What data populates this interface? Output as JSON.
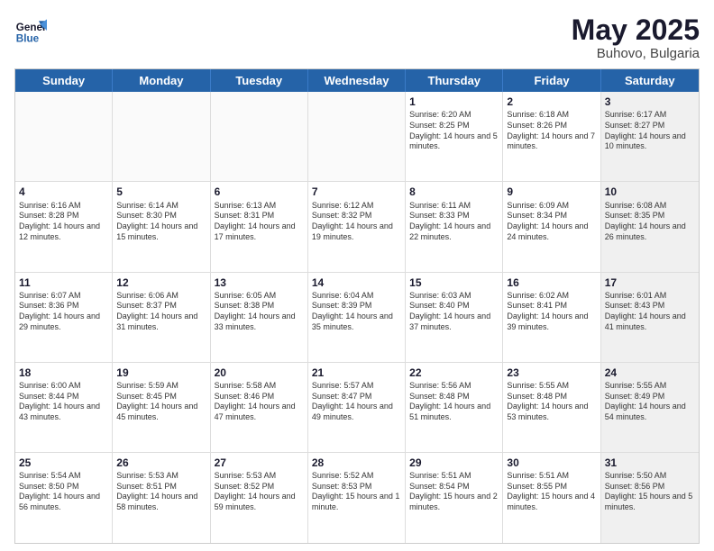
{
  "header": {
    "logo_general": "General",
    "logo_blue": "Blue",
    "title": "May 2025",
    "subtitle": "Buhovo, Bulgaria"
  },
  "days": [
    "Sunday",
    "Monday",
    "Tuesday",
    "Wednesday",
    "Thursday",
    "Friday",
    "Saturday"
  ],
  "weeks": [
    [
      {
        "day": "",
        "empty": true
      },
      {
        "day": "",
        "empty": true
      },
      {
        "day": "",
        "empty": true
      },
      {
        "day": "",
        "empty": true
      },
      {
        "day": "1",
        "sunrise": "Sunrise: 6:20 AM",
        "sunset": "Sunset: 8:25 PM",
        "daylight": "Daylight: 14 hours and 5 minutes."
      },
      {
        "day": "2",
        "sunrise": "Sunrise: 6:18 AM",
        "sunset": "Sunset: 8:26 PM",
        "daylight": "Daylight: 14 hours and 7 minutes."
      },
      {
        "day": "3",
        "sunrise": "Sunrise: 6:17 AM",
        "sunset": "Sunset: 8:27 PM",
        "daylight": "Daylight: 14 hours and 10 minutes.",
        "shaded": true
      }
    ],
    [
      {
        "day": "4",
        "sunrise": "Sunrise: 6:16 AM",
        "sunset": "Sunset: 8:28 PM",
        "daylight": "Daylight: 14 hours and 12 minutes."
      },
      {
        "day": "5",
        "sunrise": "Sunrise: 6:14 AM",
        "sunset": "Sunset: 8:30 PM",
        "daylight": "Daylight: 14 hours and 15 minutes."
      },
      {
        "day": "6",
        "sunrise": "Sunrise: 6:13 AM",
        "sunset": "Sunset: 8:31 PM",
        "daylight": "Daylight: 14 hours and 17 minutes."
      },
      {
        "day": "7",
        "sunrise": "Sunrise: 6:12 AM",
        "sunset": "Sunset: 8:32 PM",
        "daylight": "Daylight: 14 hours and 19 minutes."
      },
      {
        "day": "8",
        "sunrise": "Sunrise: 6:11 AM",
        "sunset": "Sunset: 8:33 PM",
        "daylight": "Daylight: 14 hours and 22 minutes."
      },
      {
        "day": "9",
        "sunrise": "Sunrise: 6:09 AM",
        "sunset": "Sunset: 8:34 PM",
        "daylight": "Daylight: 14 hours and 24 minutes."
      },
      {
        "day": "10",
        "sunrise": "Sunrise: 6:08 AM",
        "sunset": "Sunset: 8:35 PM",
        "daylight": "Daylight: 14 hours and 26 minutes.",
        "shaded": true
      }
    ],
    [
      {
        "day": "11",
        "sunrise": "Sunrise: 6:07 AM",
        "sunset": "Sunset: 8:36 PM",
        "daylight": "Daylight: 14 hours and 29 minutes."
      },
      {
        "day": "12",
        "sunrise": "Sunrise: 6:06 AM",
        "sunset": "Sunset: 8:37 PM",
        "daylight": "Daylight: 14 hours and 31 minutes."
      },
      {
        "day": "13",
        "sunrise": "Sunrise: 6:05 AM",
        "sunset": "Sunset: 8:38 PM",
        "daylight": "Daylight: 14 hours and 33 minutes."
      },
      {
        "day": "14",
        "sunrise": "Sunrise: 6:04 AM",
        "sunset": "Sunset: 8:39 PM",
        "daylight": "Daylight: 14 hours and 35 minutes."
      },
      {
        "day": "15",
        "sunrise": "Sunrise: 6:03 AM",
        "sunset": "Sunset: 8:40 PM",
        "daylight": "Daylight: 14 hours and 37 minutes."
      },
      {
        "day": "16",
        "sunrise": "Sunrise: 6:02 AM",
        "sunset": "Sunset: 8:41 PM",
        "daylight": "Daylight: 14 hours and 39 minutes."
      },
      {
        "day": "17",
        "sunrise": "Sunrise: 6:01 AM",
        "sunset": "Sunset: 8:43 PM",
        "daylight": "Daylight: 14 hours and 41 minutes.",
        "shaded": true
      }
    ],
    [
      {
        "day": "18",
        "sunrise": "Sunrise: 6:00 AM",
        "sunset": "Sunset: 8:44 PM",
        "daylight": "Daylight: 14 hours and 43 minutes."
      },
      {
        "day": "19",
        "sunrise": "Sunrise: 5:59 AM",
        "sunset": "Sunset: 8:45 PM",
        "daylight": "Daylight: 14 hours and 45 minutes."
      },
      {
        "day": "20",
        "sunrise": "Sunrise: 5:58 AM",
        "sunset": "Sunset: 8:46 PM",
        "daylight": "Daylight: 14 hours and 47 minutes."
      },
      {
        "day": "21",
        "sunrise": "Sunrise: 5:57 AM",
        "sunset": "Sunset: 8:47 PM",
        "daylight": "Daylight: 14 hours and 49 minutes."
      },
      {
        "day": "22",
        "sunrise": "Sunrise: 5:56 AM",
        "sunset": "Sunset: 8:48 PM",
        "daylight": "Daylight: 14 hours and 51 minutes."
      },
      {
        "day": "23",
        "sunrise": "Sunrise: 5:55 AM",
        "sunset": "Sunset: 8:48 PM",
        "daylight": "Daylight: 14 hours and 53 minutes."
      },
      {
        "day": "24",
        "sunrise": "Sunrise: 5:55 AM",
        "sunset": "Sunset: 8:49 PM",
        "daylight": "Daylight: 14 hours and 54 minutes.",
        "shaded": true
      }
    ],
    [
      {
        "day": "25",
        "sunrise": "Sunrise: 5:54 AM",
        "sunset": "Sunset: 8:50 PM",
        "daylight": "Daylight: 14 hours and 56 minutes."
      },
      {
        "day": "26",
        "sunrise": "Sunrise: 5:53 AM",
        "sunset": "Sunset: 8:51 PM",
        "daylight": "Daylight: 14 hours and 58 minutes."
      },
      {
        "day": "27",
        "sunrise": "Sunrise: 5:53 AM",
        "sunset": "Sunset: 8:52 PM",
        "daylight": "Daylight: 14 hours and 59 minutes."
      },
      {
        "day": "28",
        "sunrise": "Sunrise: 5:52 AM",
        "sunset": "Sunset: 8:53 PM",
        "daylight": "Daylight: 15 hours and 1 minute."
      },
      {
        "day": "29",
        "sunrise": "Sunrise: 5:51 AM",
        "sunset": "Sunset: 8:54 PM",
        "daylight": "Daylight: 15 hours and 2 minutes."
      },
      {
        "day": "30",
        "sunrise": "Sunrise: 5:51 AM",
        "sunset": "Sunset: 8:55 PM",
        "daylight": "Daylight: 15 hours and 4 minutes."
      },
      {
        "day": "31",
        "sunrise": "Sunrise: 5:50 AM",
        "sunset": "Sunset: 8:56 PM",
        "daylight": "Daylight: 15 hours and 5 minutes.",
        "shaded": true
      }
    ]
  ]
}
